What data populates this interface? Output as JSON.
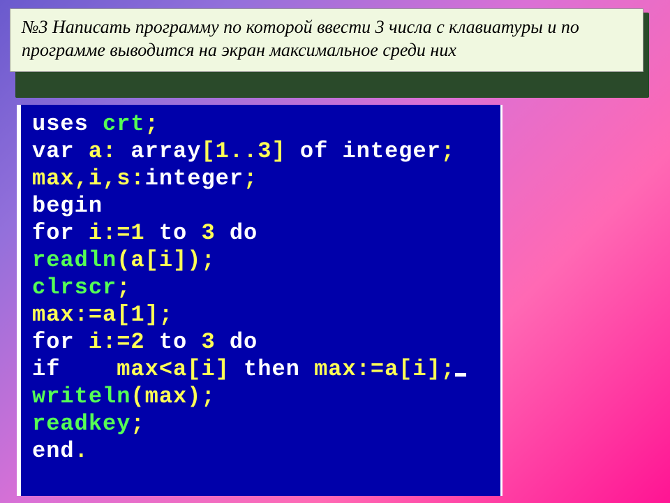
{
  "task": {
    "text": "№3  Написать программу по которой ввести 3 числа с клавиатуры и по программе выводится на экран максимальное среди них"
  },
  "code": {
    "line1_uses": "uses",
    "line1_crt": " crt",
    "line1_semi": ";",
    "line2_var": "var",
    "line2_a": " a",
    "line2_colon": ":",
    "line2_arr": " array",
    "line2_br": "[",
    "line2_range": "1..3",
    "line2_br2": "] ",
    "line2_of": "of",
    "line2_sp": " ",
    "line2_int": "integer",
    "line2_s": ";",
    "line3_max": "max",
    "line3_c1": ",",
    "line3_i": "i",
    "line3_c2": ",",
    "line3_s": "s",
    "line3_col": ":",
    "line3_int": "integer",
    "line3_sc": ";",
    "line4_begin": "begin",
    "line5_for": "for",
    "line5_ia": " i:=1 ",
    "line5_to": "to",
    "line5_3": " 3 ",
    "line5_do": "do",
    "line6_readln": "readln",
    "line6_pa": "(a[i]);",
    "line7_clr": "clrscr",
    "line7_s": ";",
    "line8_max": "max:=a[1];",
    "line9_for": "for",
    "line9_i2": " i:=2 ",
    "line9_to": "to",
    "line9_3": " 3 ",
    "line9_do": "do",
    "line10_if": "if",
    "line10_sp": "    ",
    "line10_cond": "max<a[i] ",
    "line10_then": "then",
    "line10_asn": " max:=a[i];",
    "line11_wr": "writeln",
    "line11_pa": "(max);",
    "line12_rk": "readkey",
    "line12_s": ";",
    "line13_end": "end",
    "line13_d": "."
  }
}
